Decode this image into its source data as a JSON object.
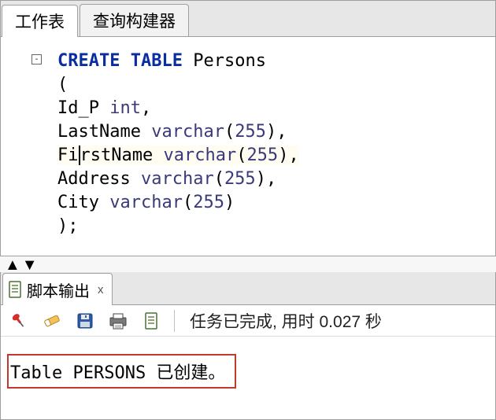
{
  "top": {
    "tabs": {
      "worksheet": "工作表",
      "querybuilder": "查询构建器"
    },
    "code": {
      "kw_create": "CREATE",
      "kw_table": "TABLE",
      "ident_table": "Persons",
      "open": "(",
      "col1_name": "Id_P",
      "col1_type": "int",
      "comma": ",",
      "col2_name": "LastName",
      "col2_type": "varchar",
      "lp": "(",
      "rp": ")",
      "size": "255",
      "col3_first": "Fi",
      "col3_rest": "rstName",
      "col4_name": "Address",
      "col5_name": "City",
      "close": ");",
      "fold_glyph": "-"
    },
    "scroll_glyph": "▲▼"
  },
  "bottom": {
    "tab": {
      "label": "脚本输出",
      "close_glyph": "x"
    },
    "status": "任务已完成, 用时 0.027 秒",
    "output_line": "Table PERSONS 已创建。"
  }
}
